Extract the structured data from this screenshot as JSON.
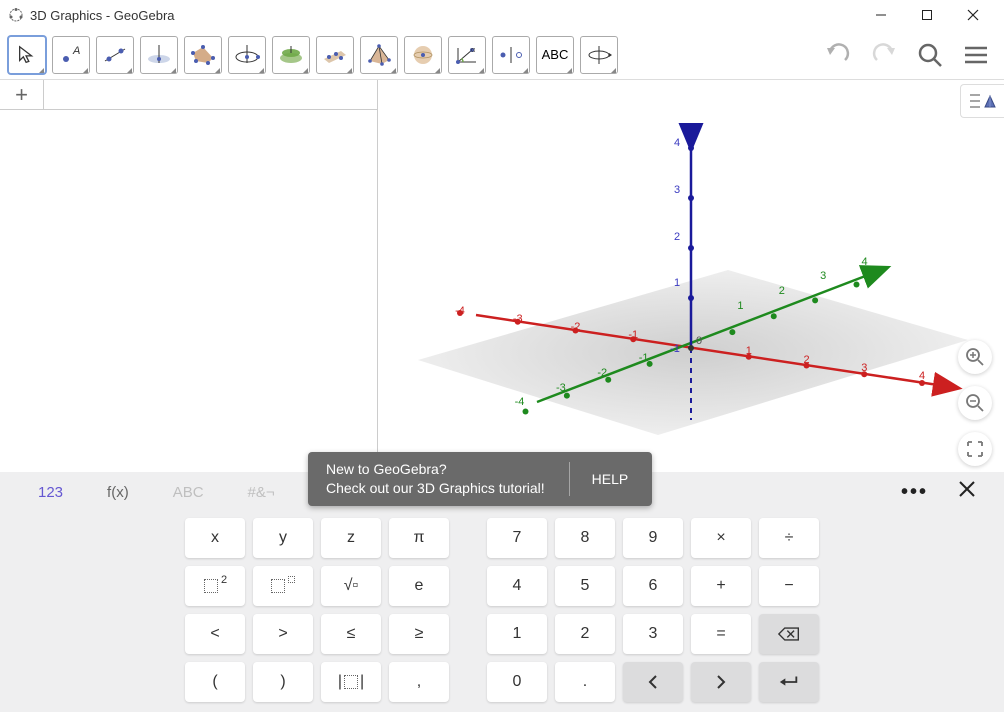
{
  "window": {
    "title": "3D Graphics - GeoGebra"
  },
  "toolbar": {
    "tools": [
      {
        "name": "move-tool",
        "selected": true
      },
      {
        "name": "point-tool"
      },
      {
        "name": "line-tool"
      },
      {
        "name": "perpendicular-tool"
      },
      {
        "name": "polygon-tool"
      },
      {
        "name": "circle-tool"
      },
      {
        "name": "intersect-tool"
      },
      {
        "name": "plane-tool"
      },
      {
        "name": "pyramid-tool"
      },
      {
        "name": "sphere-tool"
      },
      {
        "name": "angle-tool"
      },
      {
        "name": "reflect-tool"
      },
      {
        "name": "text-tool",
        "label": "ABC"
      },
      {
        "name": "rotate-view-tool"
      }
    ]
  },
  "tabstrip": {
    "plus": "+"
  },
  "scene": {
    "zAxis": {
      "ticks": [
        "1",
        "2",
        "3",
        "4"
      ],
      "negTicks": [
        "-1"
      ]
    },
    "xAxis": {
      "posTicks": [
        "1",
        "2",
        "3",
        "4"
      ],
      "negTicks": [
        "-1",
        "-2",
        "-3",
        "-4"
      ]
    },
    "yAxis": {
      "posTicks": [
        "1",
        "2",
        "3",
        "4"
      ],
      "negTicks": [
        "-1",
        "-2",
        "-3",
        "-4"
      ]
    },
    "origin": "0"
  },
  "notification": {
    "line1": "New to GeoGebra?",
    "line2": "Check out our 3D Graphics tutorial!",
    "help": "HELP"
  },
  "inputModes": {
    "num": "123",
    "fx": "f(x)",
    "abc": "ABC",
    "sym": "#&¬"
  },
  "keyboard": {
    "rows": [
      [
        {
          "label": "x",
          "name": "key-x"
        },
        {
          "label": "y",
          "name": "key-y"
        },
        {
          "label": "z",
          "name": "key-z"
        },
        {
          "label": "π",
          "name": "key-pi"
        },
        {
          "gap": true
        },
        {
          "label": "7",
          "name": "key-7"
        },
        {
          "label": "8",
          "name": "key-8"
        },
        {
          "label": "9",
          "name": "key-9"
        },
        {
          "label": "×",
          "name": "key-multiply"
        },
        {
          "label": "÷",
          "name": "key-divide"
        }
      ],
      [
        {
          "icon": "box-sq",
          "name": "key-square"
        },
        {
          "icon": "box-pow",
          "name": "key-power"
        },
        {
          "label": "√▫",
          "name": "key-sqrt"
        },
        {
          "label": "e",
          "name": "key-e"
        },
        {
          "gap": true
        },
        {
          "label": "4",
          "name": "key-4"
        },
        {
          "label": "5",
          "name": "key-5"
        },
        {
          "label": "6",
          "name": "key-6"
        },
        {
          "label": "+",
          "name": "key-plus"
        },
        {
          "label": "−",
          "name": "key-minus"
        }
      ],
      [
        {
          "label": "<",
          "name": "key-lt"
        },
        {
          "label": ">",
          "name": "key-gt"
        },
        {
          "label": "≤",
          "name": "key-le"
        },
        {
          "label": "≥",
          "name": "key-ge"
        },
        {
          "gap": true
        },
        {
          "label": "1",
          "name": "key-1"
        },
        {
          "label": "2",
          "name": "key-2"
        },
        {
          "label": "3",
          "name": "key-3"
        },
        {
          "label": "=",
          "name": "key-eq"
        },
        {
          "icon": "backspace",
          "name": "key-backspace",
          "grey": true
        }
      ],
      [
        {
          "label": "(",
          "name": "key-lparen"
        },
        {
          "label": ")",
          "name": "key-rparen"
        },
        {
          "icon": "abs",
          "name": "key-abs"
        },
        {
          "label": ",",
          "name": "key-comma"
        },
        {
          "gap": true
        },
        {
          "label": "0",
          "name": "key-0"
        },
        {
          "label": ".",
          "name": "key-dot"
        },
        {
          "icon": "left",
          "name": "key-left",
          "grey": true
        },
        {
          "icon": "right",
          "name": "key-right",
          "grey": true
        },
        {
          "icon": "enter",
          "name": "key-enter",
          "grey": true
        }
      ]
    ]
  }
}
